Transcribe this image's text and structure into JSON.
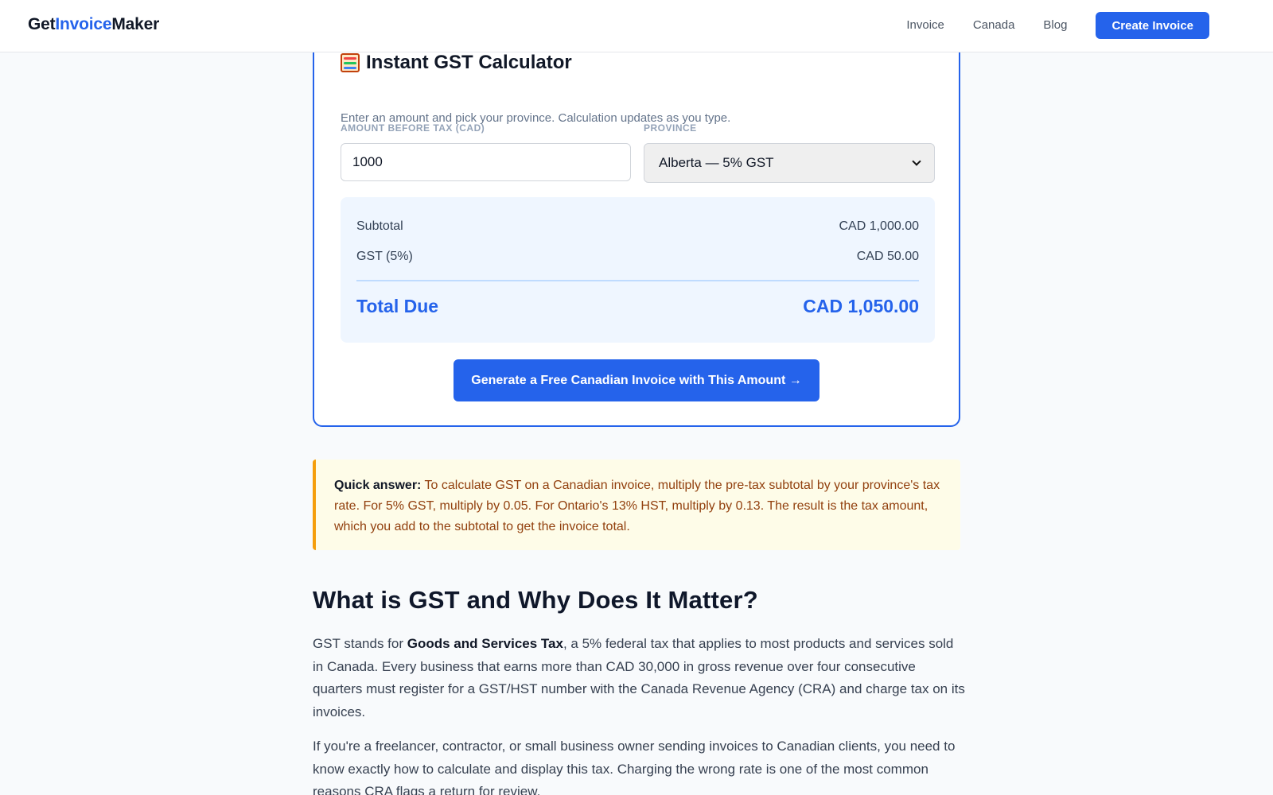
{
  "header": {
    "logo": {
      "part1": "Get",
      "part2": "Invoice",
      "part3": "Maker"
    },
    "nav": [
      "Invoice",
      "Canada",
      "Blog"
    ],
    "cta_label": "Create Invoice"
  },
  "calculator": {
    "title": "Instant GST Calculator",
    "subtitle": "Enter an amount and pick your province. Calculation updates as you type.",
    "amount_label": "AMOUNT BEFORE TAX (CAD)",
    "amount_value": "1000",
    "province_label": "PROVINCE",
    "province_selected": "Alberta — 5% GST",
    "subtotal_label": "Subtotal",
    "subtotal_value": "CAD 1,000.00",
    "gst_label": "GST (5%)",
    "gst_value": "CAD 50.00",
    "total_label": "Total Due",
    "total_value": "CAD 1,050.00",
    "generate_label": "Generate a Free Canadian Invoice with This Amount →"
  },
  "quick_answer": {
    "label": "Quick answer:",
    "text": "To calculate GST on a Canadian invoice, multiply the pre-tax subtotal by your province's tax rate. For 5% GST, multiply by 0.05. For Ontario's 13% HST, multiply by 0.13. The result is the tax amount, which you add to the subtotal to get the invoice total."
  },
  "article": {
    "heading": "What is GST and Why Does It Matter?",
    "p1_before": "GST stands for ",
    "p1_bold": "Goods and Services Tax",
    "p1_after": ", a 5% federal tax that applies to most products and services sold in Canada. Every business that earns more than CAD 30,000 in gross revenue over four consecutive quarters must register for a GST/HST number with the Canada Revenue Agency (CRA) and charge tax on its invoices.",
    "p2": "If you're a freelancer, contractor, or small business owner sending invoices to Canadian clients, you need to know exactly how to calculate and display this tax. Charging the wrong rate is one of the most common reasons CRA flags a return for review."
  },
  "colors": {
    "accent": "#2563eb",
    "quick_border": "#f59e0b",
    "quick_bg": "#fefce8"
  }
}
